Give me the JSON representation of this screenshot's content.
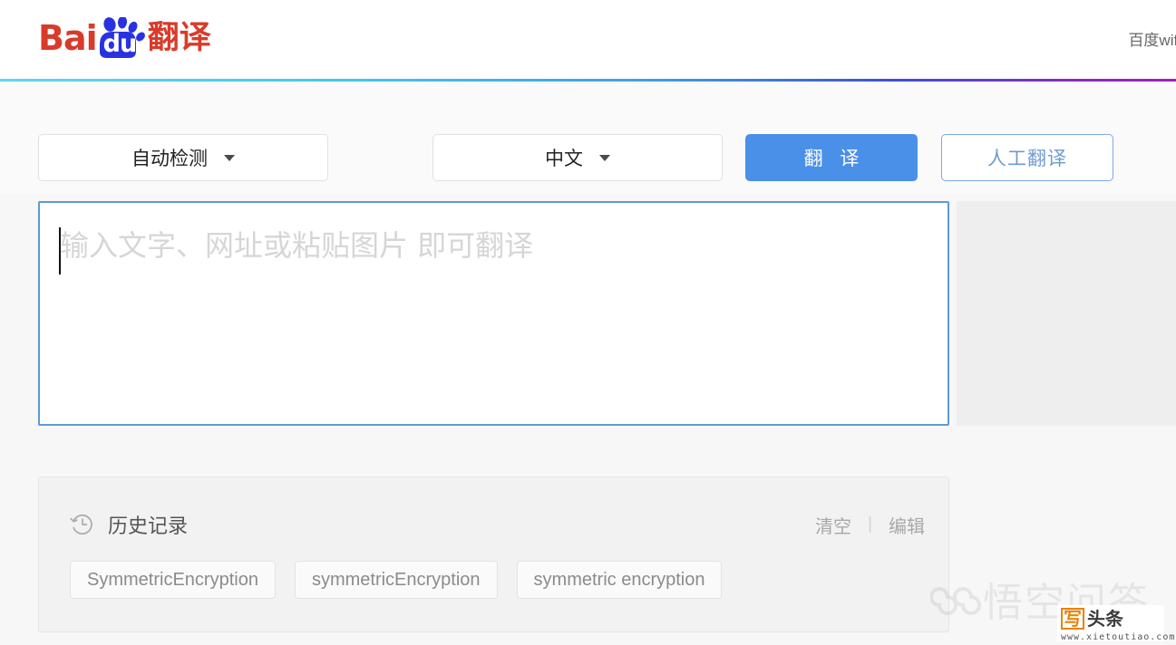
{
  "header": {
    "logo": {
      "bai_text": "Bai",
      "du_text": "du",
      "product_text": "翻译",
      "paw_icon": "paw-print-icon",
      "brand_red": "#d93b2b",
      "brand_blue": "#2932e1"
    },
    "nav_link": "百度wifi",
    "accent_gradient": [
      "#5fd6ef",
      "#3f9ee0",
      "#a020c0"
    ]
  },
  "toolbar": {
    "source_language": "自动检测",
    "target_language": "中文",
    "swap_icon": "swap-arrows-icon",
    "caret_icon": "chevron-down-icon",
    "translate_button": "翻 译",
    "human_translate_button": "人工翻译",
    "translate_button_color": "#4a90e8",
    "human_button_border": "#7aa9dd",
    "human_button_text_color": "#6f9bd0"
  },
  "editor": {
    "input_placeholder": "输入文字、网址或粘贴图片 即可翻译",
    "input_value": "",
    "focus_border_color": "#5b9bd5",
    "output_value": ""
  },
  "history": {
    "icon": "clock-history-icon",
    "title": "历史记录",
    "clear_label": "清空",
    "separator": "|",
    "edit_label": "编辑",
    "items": [
      "SymmetricEncryption",
      "symmetricEncryption",
      "symmetric encryption"
    ]
  },
  "watermarks": {
    "wukong_text": "悟空问答",
    "wukong_icon": "wukong-cloud-icon",
    "badge_xie": "写",
    "badge_toutiao": "头条",
    "badge_url": "www.xietoutiao.com",
    "badge_accent": "#e8830c"
  }
}
